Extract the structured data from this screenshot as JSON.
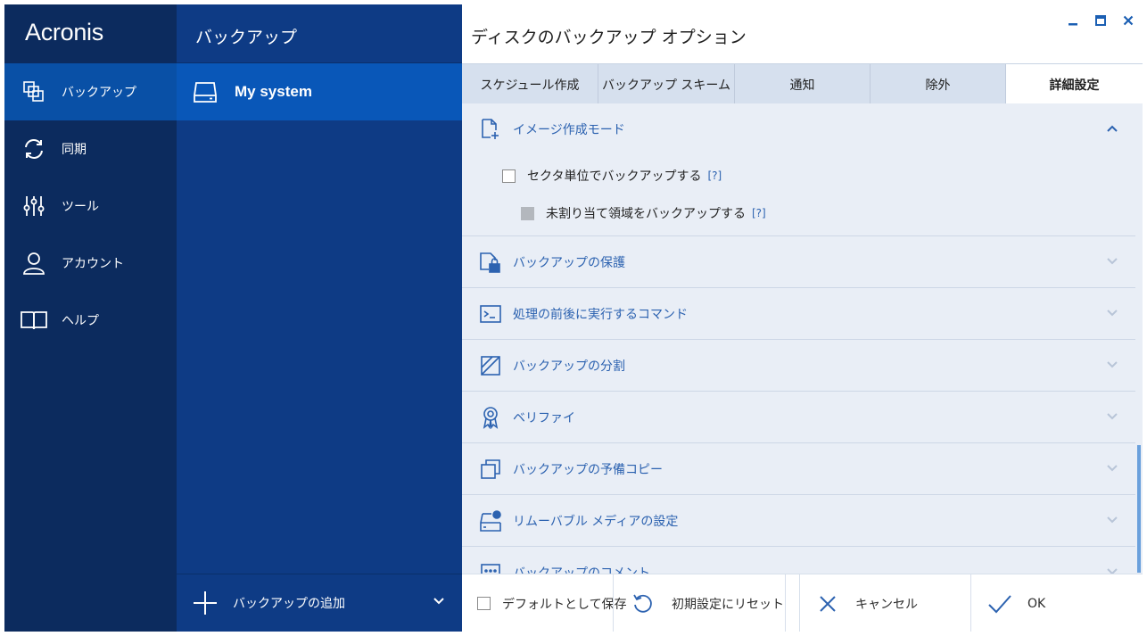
{
  "app": {
    "logo_text": "Acronis"
  },
  "nav": {
    "items": [
      {
        "label": "バックアップ",
        "icon": "backup-icon",
        "active": true
      },
      {
        "label": "同期",
        "icon": "sync-icon",
        "active": false
      },
      {
        "label": "ツール",
        "icon": "tools-icon",
        "active": false
      },
      {
        "label": "アカウント",
        "icon": "account-icon",
        "active": false
      },
      {
        "label": "ヘルプ",
        "icon": "help-book-icon",
        "active": false
      }
    ]
  },
  "backups": {
    "title": "バックアップ",
    "items": [
      {
        "label": "My system",
        "icon": "drive-icon"
      }
    ],
    "add_label": "バックアップの追加"
  },
  "options": {
    "title": "ディスクのバックアップ オプション",
    "tabs": [
      {
        "label": "スケジュール作成",
        "active": false
      },
      {
        "label": "バックアップ スキーム",
        "active": false
      },
      {
        "label": "通知",
        "active": false
      },
      {
        "label": "除外",
        "active": false
      },
      {
        "label": "詳細設定",
        "active": true
      }
    ],
    "sections": [
      {
        "label": "イメージ作成モード",
        "icon": "image-mode-icon",
        "expanded": true
      },
      {
        "label": "バックアップの保護",
        "icon": "lock-icon",
        "expanded": false
      },
      {
        "label": "処理の前後に実行するコマンド",
        "icon": "command-icon",
        "expanded": false
      },
      {
        "label": "バックアップの分割",
        "icon": "split-icon",
        "expanded": false
      },
      {
        "label": "ベリファイ",
        "icon": "verify-icon",
        "expanded": false
      },
      {
        "label": "バックアップの予備コピー",
        "icon": "copy-icon",
        "expanded": false
      },
      {
        "label": "リムーバブル メディアの設定",
        "icon": "removable-media-icon",
        "expanded": false
      },
      {
        "label": "バックアップのコメント",
        "icon": "comment-icon",
        "expanded": false
      }
    ],
    "image_mode": {
      "sector_by_sector": {
        "label": "セクタ単位でバックアップする",
        "help": "[?]",
        "checked": false
      },
      "unallocated": {
        "label": "未割り当て領域をバックアップする",
        "help": "[?]",
        "checked": false,
        "disabled": true
      }
    }
  },
  "footer": {
    "save_default": "デフォルトとして保存",
    "reset": "初期設定にリセット",
    "cancel": "キャンセル",
    "ok": "OK"
  },
  "colors": {
    "nav_bg": "#0c2b5e",
    "mid_bg": "#0e3b85",
    "active_item": "#0957b8",
    "accent": "#2c62b0"
  }
}
